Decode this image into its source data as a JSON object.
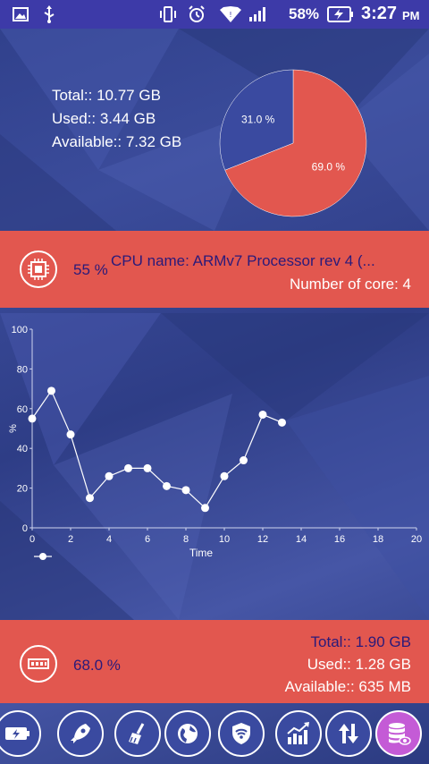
{
  "status_bar": {
    "battery_percent": "58%",
    "time": "3:27",
    "ampm": "PM"
  },
  "storage": {
    "total": "Total:: 10.77 GB",
    "used": "Used:: 3.44 GB",
    "available": "Available:: 7.32 GB",
    "pie": {
      "slices": [
        {
          "label": "69.0 %",
          "value": 69.0,
          "color": "#e2574f"
        },
        {
          "label": "31.0 %",
          "value": 31.0,
          "color": "#3a4aa0"
        }
      ]
    }
  },
  "cpu": {
    "usage": "55 %",
    "name": "CPU name: ARMv7 Processor rev 4 (...",
    "cores": "Number of core: 4"
  },
  "chart_data": {
    "type": "line",
    "x": [
      0,
      1,
      2,
      3,
      4,
      5,
      6,
      7,
      8,
      9,
      10,
      11,
      12,
      13
    ],
    "series": [
      {
        "values": [
          55,
          69,
          47,
          15,
          26,
          30,
          30,
          21,
          19,
          10,
          26,
          34,
          57,
          53
        ]
      }
    ],
    "xlabel": "Time",
    "ylabel": "%",
    "xlim": [
      0,
      20
    ],
    "ylim": [
      0,
      100
    ],
    "xticks": [
      "0",
      "2",
      "4",
      "6",
      "8",
      "10",
      "12",
      "14",
      "16",
      "18",
      "20"
    ],
    "yticks": [
      "0",
      "20",
      "40",
      "60",
      "80",
      "100"
    ],
    "grid": false,
    "line_color": "#ffffff"
  },
  "ram": {
    "usage": "68.0 %",
    "total": "Total:: 1.90 GB",
    "used": "Used:: 1.28 GB",
    "available": "Available:: 635 MB"
  },
  "bottom_nav": {
    "items": [
      {
        "name": "battery-icon"
      },
      {
        "name": "rocket-icon"
      },
      {
        "name": "broom-icon"
      },
      {
        "name": "globe-icon"
      },
      {
        "name": "shield-wifi-icon"
      },
      {
        "name": "trend-chart-icon"
      },
      {
        "name": "up-down-arrows-icon"
      },
      {
        "name": "database-eye-icon",
        "active": true
      }
    ]
  }
}
